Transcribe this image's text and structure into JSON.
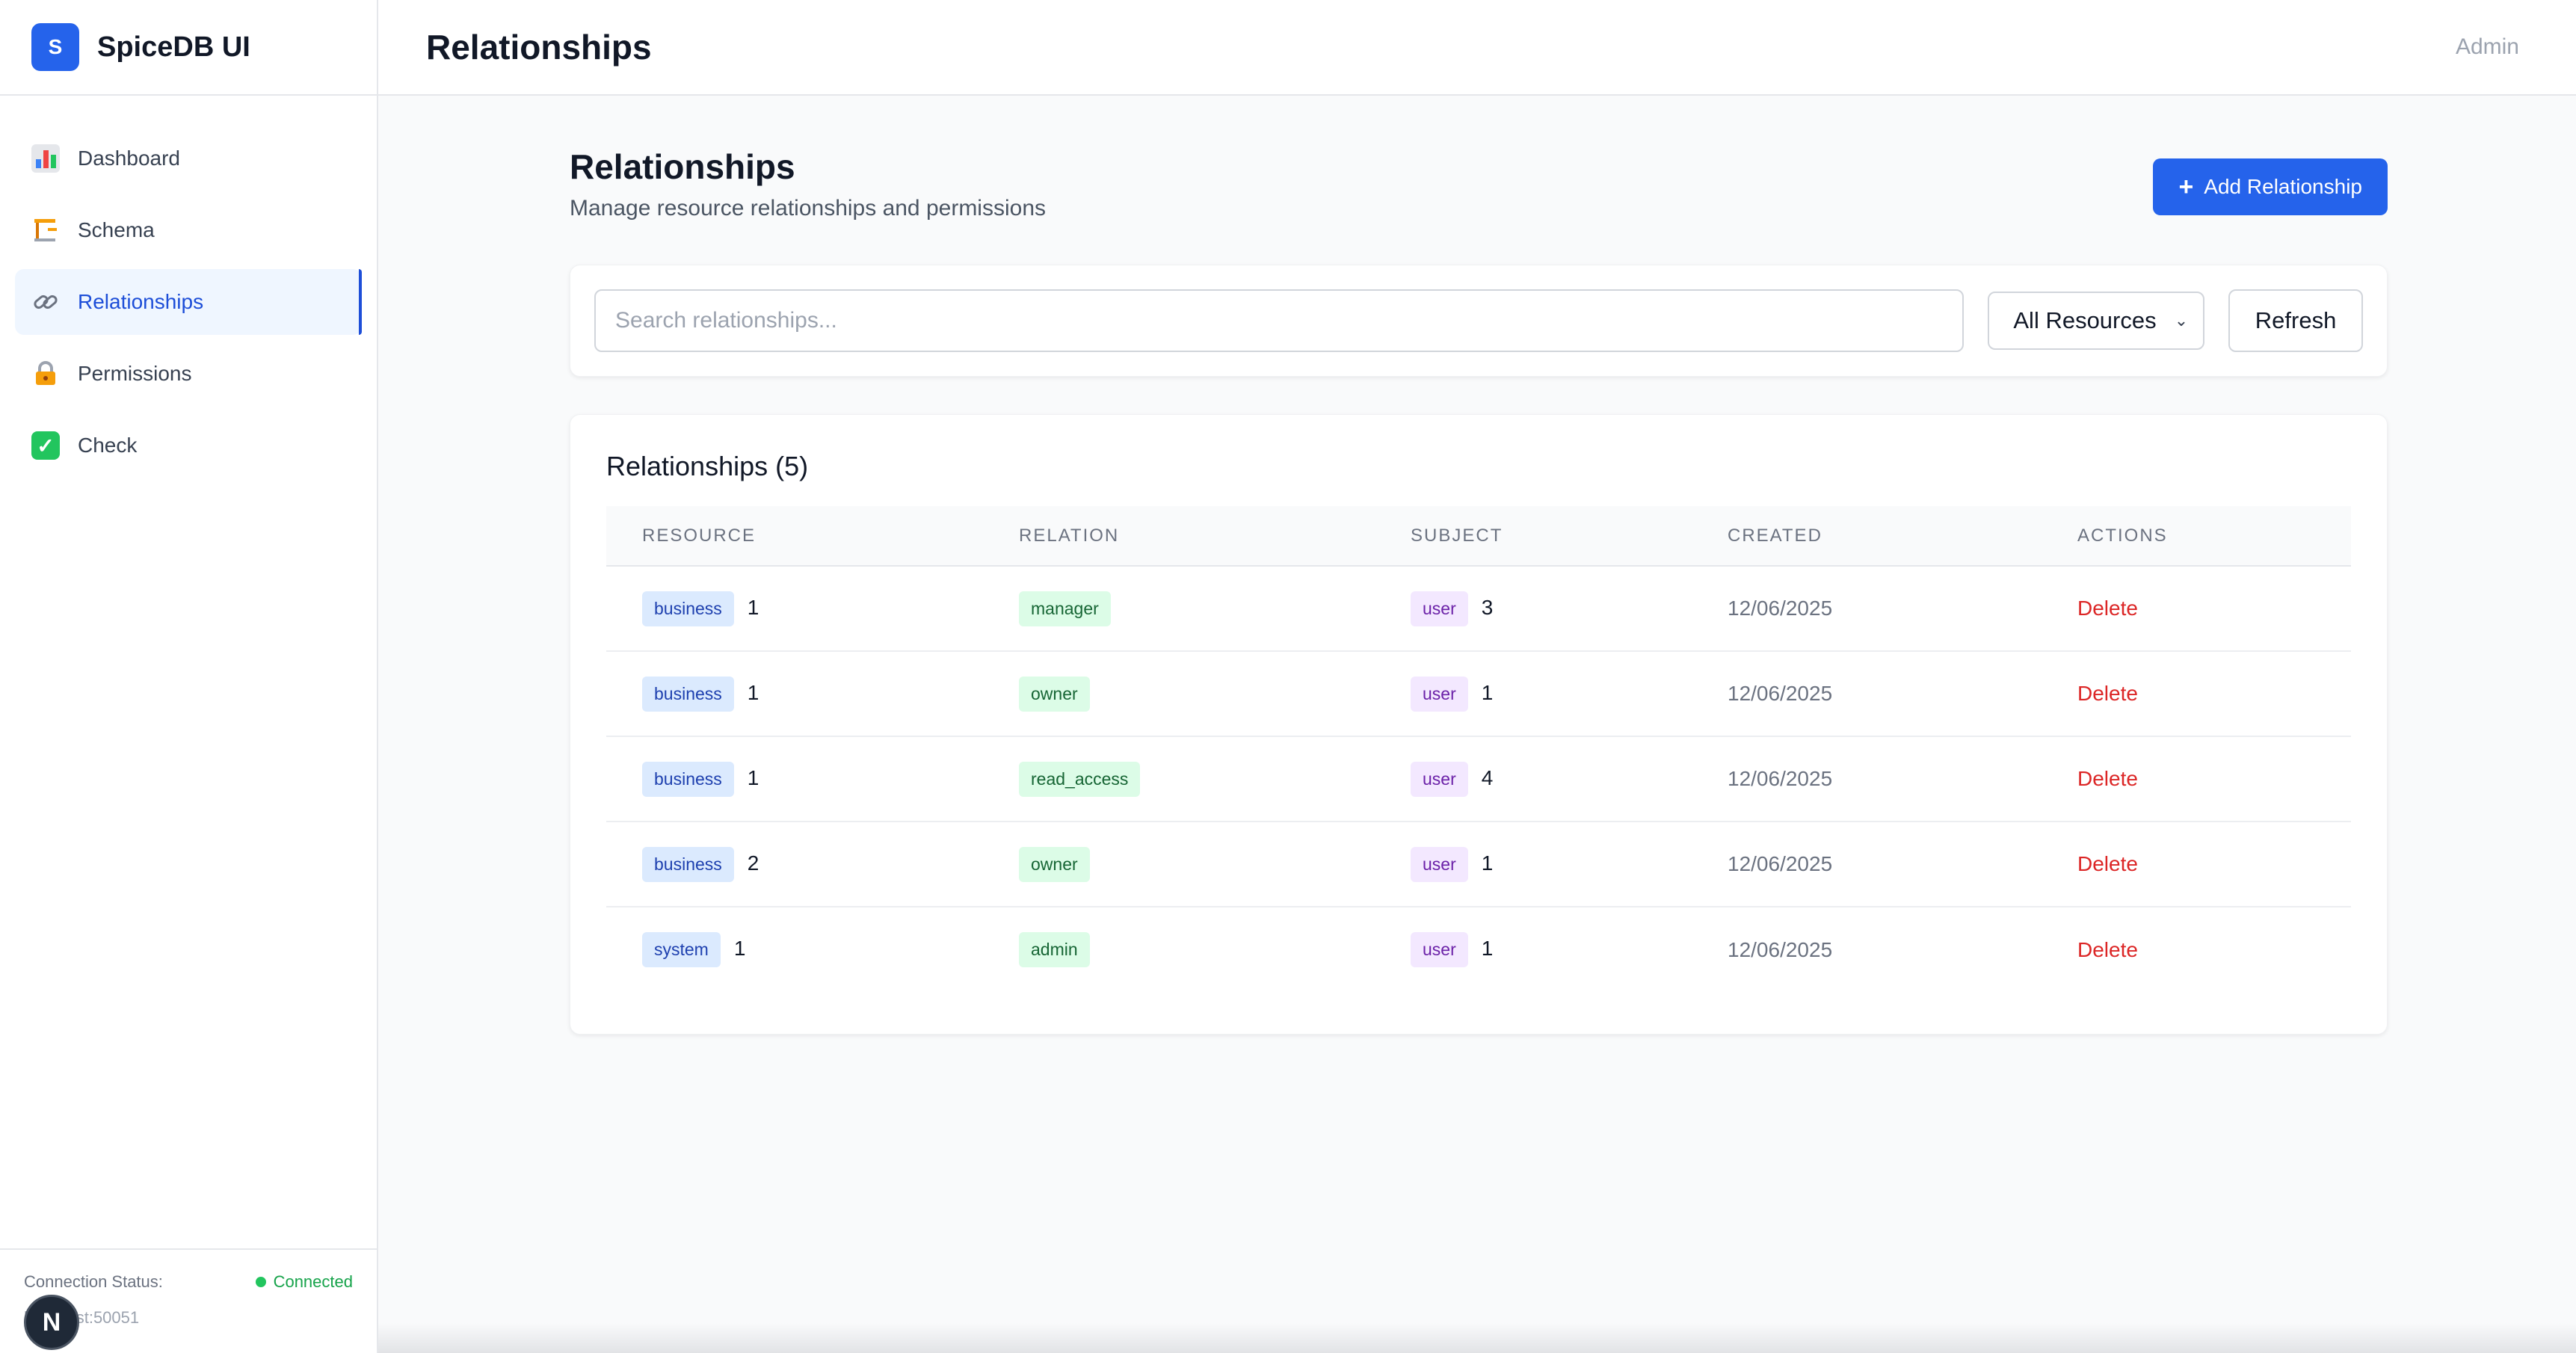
{
  "brand": {
    "logo_letter": "S",
    "title": "SpiceDB UI"
  },
  "sidebar": {
    "items": [
      {
        "label": "Dashboard",
        "icon": "bar-chart-icon",
        "active": false
      },
      {
        "label": "Schema",
        "icon": "schema-icon",
        "active": false
      },
      {
        "label": "Relationships",
        "icon": "link-icon",
        "active": true
      },
      {
        "label": "Permissions",
        "icon": "lock-icon",
        "active": false
      },
      {
        "label": "Check",
        "icon": "check-icon",
        "active": false
      }
    ],
    "footer": {
      "connection_label": "Connection Status:",
      "status": "Connected",
      "host": "localhost:50051",
      "badge_letter": "N"
    }
  },
  "header": {
    "title": "Relationships",
    "user": "Admin"
  },
  "page": {
    "title": "Relationships",
    "subtitle": "Manage resource relationships and permissions",
    "add_button": "Add Relationship",
    "search_placeholder": "Search relationships...",
    "filter_selected": "All Resources",
    "refresh_button": "Refresh"
  },
  "table": {
    "title": "Relationships",
    "count": "(5)",
    "columns": [
      "RESOURCE",
      "RELATION",
      "SUBJECT",
      "CREATED",
      "ACTIONS"
    ],
    "rows": [
      {
        "resource_type": "business",
        "resource_id": "1",
        "relation": "manager",
        "subject_type": "user",
        "subject_id": "3",
        "created": "12/06/2025",
        "action": "Delete"
      },
      {
        "resource_type": "business",
        "resource_id": "1",
        "relation": "owner",
        "subject_type": "user",
        "subject_id": "1",
        "created": "12/06/2025",
        "action": "Delete"
      },
      {
        "resource_type": "business",
        "resource_id": "1",
        "relation": "read_access",
        "subject_type": "user",
        "subject_id": "4",
        "created": "12/06/2025",
        "action": "Delete"
      },
      {
        "resource_type": "business",
        "resource_id": "2",
        "relation": "owner",
        "subject_type": "user",
        "subject_id": "1",
        "created": "12/06/2025",
        "action": "Delete"
      },
      {
        "resource_type": "system",
        "resource_id": "1",
        "relation": "admin",
        "subject_type": "user",
        "subject_id": "1",
        "created": "12/06/2025",
        "action": "Delete"
      }
    ]
  },
  "colors": {
    "accent": "#2563eb",
    "active_nav_bg": "#eff6ff",
    "connected": "#22c55e",
    "delete": "#dc2626",
    "resource_tag": "#dbeafe",
    "relation_tag": "#dcfce7",
    "subject_tag": "#f3e8ff"
  }
}
